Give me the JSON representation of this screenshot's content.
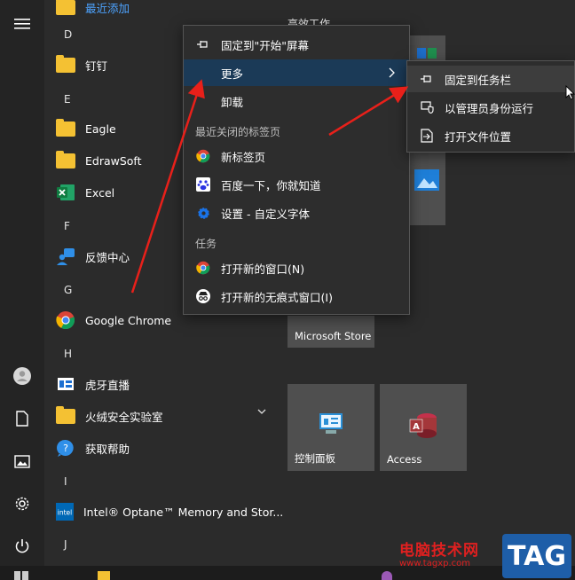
{
  "recently_added_label": "最近添加",
  "tile_group_partial": "高效工作",
  "letters": {
    "d": "D",
    "e": "E",
    "f": "F",
    "g": "G",
    "h": "H",
    "i": "I",
    "j": "J"
  },
  "apps": {
    "dingding": "钉钉",
    "eagle": "Eagle",
    "edrawsoft": "EdrawSoft",
    "excel": "Excel",
    "feedback": "反馈中心",
    "chrome": "Google Chrome",
    "huya": "虎牙直播",
    "huorong": "火绒安全实验室",
    "help": "获取帮助",
    "optane": "Intel® Optane™ Memory and Stor..."
  },
  "tiles": {
    "store": "Microsoft Store",
    "control_panel": "控制面板",
    "access": "Access"
  },
  "context_menu": {
    "pin_start": "固定到\"开始\"屏幕",
    "more": "更多",
    "uninstall": "卸载",
    "recent_section": "最近关闭的标签页",
    "new_tab": "新标签页",
    "baidu": "百度一下，你就知道",
    "settings_font": "设置 - 自定义字体",
    "tasks_section": "任务",
    "new_window": "打开新的窗口(N)",
    "incognito": "打开新的无痕式窗口(I)"
  },
  "submenu": {
    "pin_taskbar": "固定到任务栏",
    "run_admin": "以管理员身份运行",
    "open_location": "打开文件位置"
  },
  "watermark": {
    "text": "电脑技术网",
    "url": "www.tagxp.com",
    "tag": "TAG"
  },
  "colors": {
    "accent_link": "#4da3ff",
    "highlight": "#1b3a57",
    "arrow": "#e8201a",
    "folder": "#f4c133"
  }
}
